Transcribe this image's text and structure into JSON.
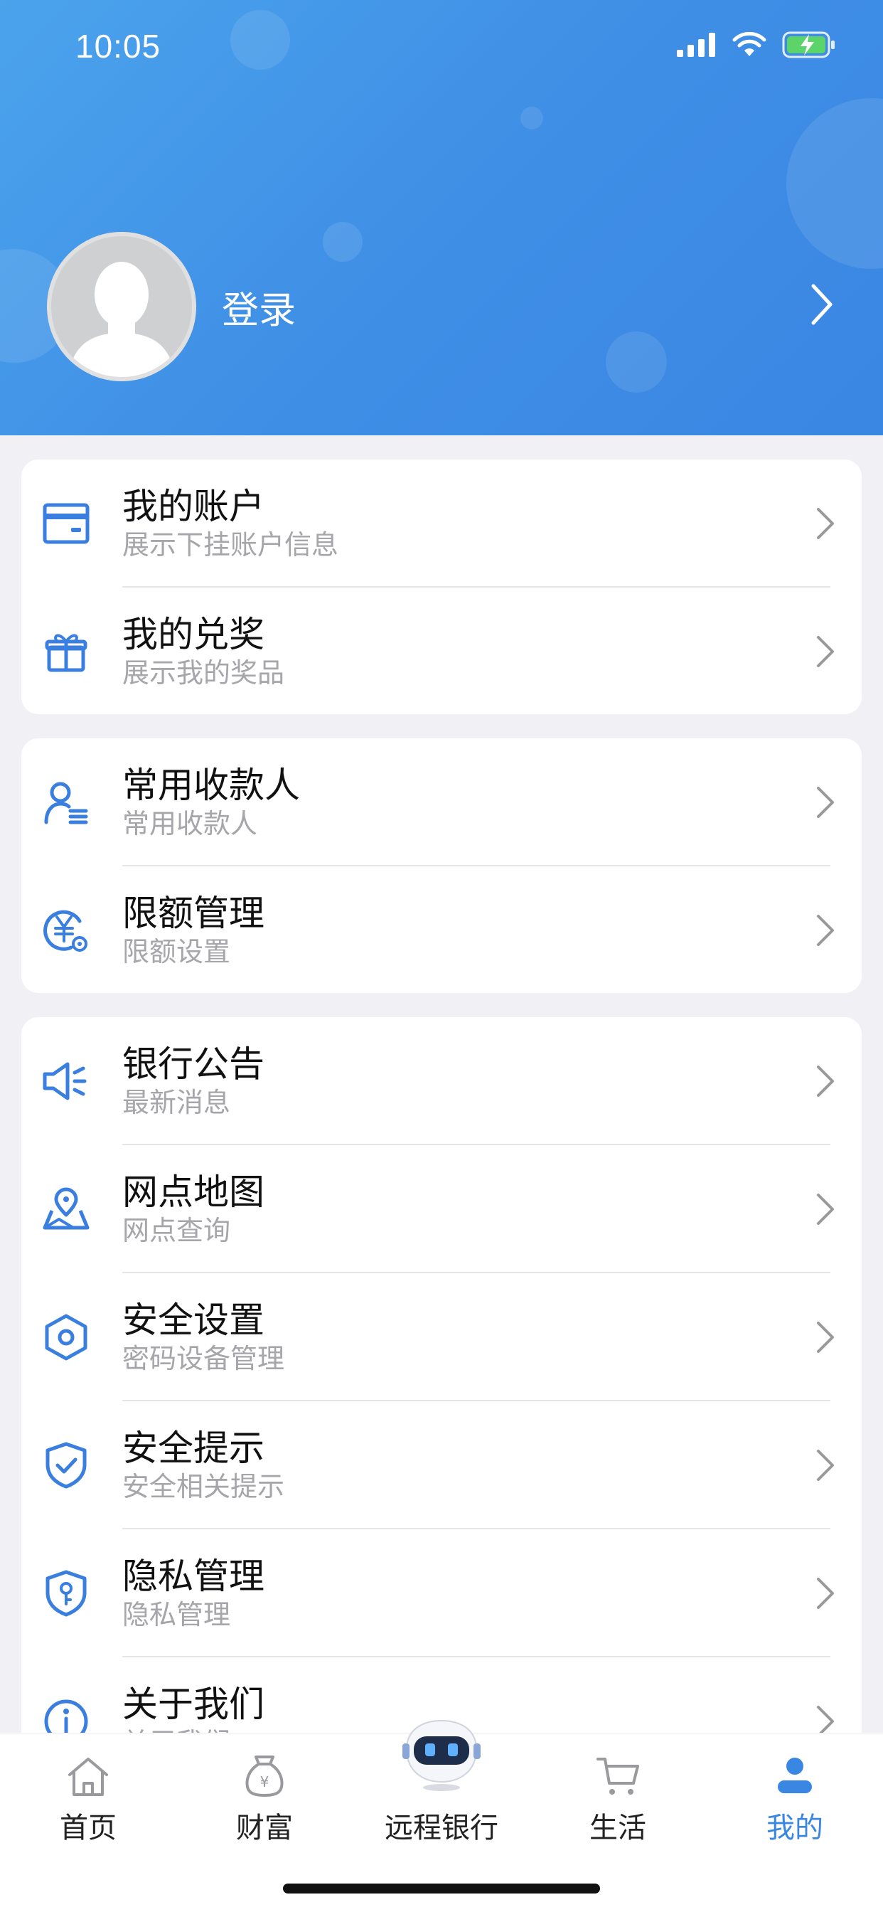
{
  "status_bar": {
    "time": "10:05"
  },
  "profile": {
    "login_label": "登录"
  },
  "menu": {
    "group1": [
      {
        "title": "我的账户",
        "subtitle": "展示下挂账户信息"
      },
      {
        "title": "我的兑奖",
        "subtitle": "展示我的奖品"
      }
    ],
    "group2": [
      {
        "title": "常用收款人",
        "subtitle": "常用收款人"
      },
      {
        "title": "限额管理",
        "subtitle": "限额设置"
      }
    ],
    "group3": [
      {
        "title": "银行公告",
        "subtitle": "最新消息"
      },
      {
        "title": "网点地图",
        "subtitle": "网点查询"
      },
      {
        "title": "安全设置",
        "subtitle": "密码设备管理"
      },
      {
        "title": "安全提示",
        "subtitle": "安全相关提示"
      },
      {
        "title": "隐私管理",
        "subtitle": "隐私管理"
      },
      {
        "title": "关于我们",
        "subtitle": "关于我们"
      }
    ]
  },
  "tabbar": {
    "tabs": [
      {
        "label": "首页",
        "icon": "home-icon"
      },
      {
        "label": "财富",
        "icon": "money-bag-icon"
      },
      {
        "label": "远程银行",
        "icon": "robot-icon"
      },
      {
        "label": "生活",
        "icon": "cart-icon"
      },
      {
        "label": "我的",
        "icon": "user-icon"
      }
    ],
    "active_index": 4
  },
  "colors": {
    "accent": "#3a86e3",
    "header_start": "#4ba3ec",
    "icon_blue": "#3a7fe0"
  }
}
